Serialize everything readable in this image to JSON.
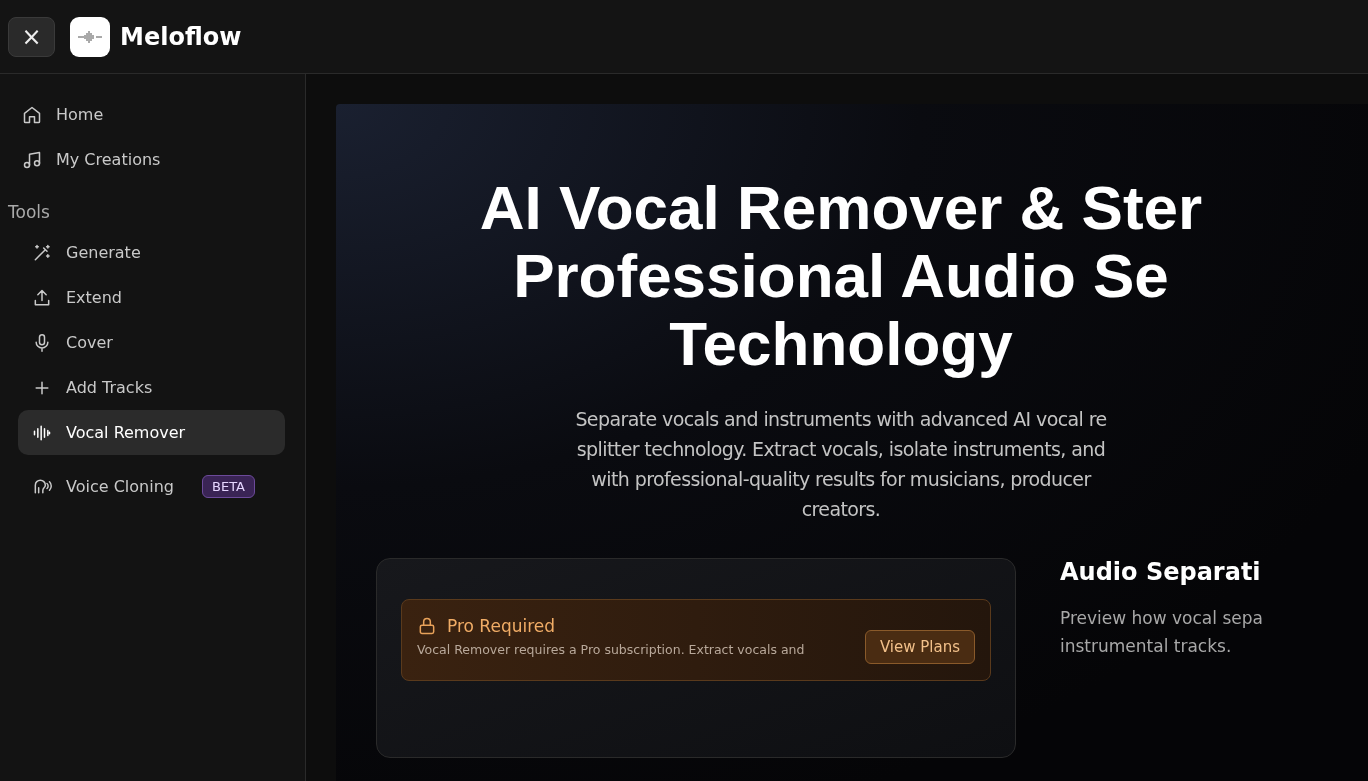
{
  "header": {
    "close_label": "×",
    "brand": "Meloflow"
  },
  "sidebar": {
    "items": [
      {
        "label": "Home",
        "selected": false
      },
      {
        "label": "My Creations",
        "selected": false
      }
    ],
    "section_title": "Tools",
    "tools": [
      {
        "label": "Generate",
        "selected": false
      },
      {
        "label": "Extend",
        "selected": false
      },
      {
        "label": "Cover",
        "selected": false
      },
      {
        "label": "Add Tracks",
        "selected": false
      },
      {
        "label": "Vocal Remover",
        "selected": true
      },
      {
        "label": "Voice Cloning",
        "selected": false,
        "badge": "BETA"
      }
    ]
  },
  "hero": {
    "title_lines": [
      "AI Vocal Remover & Ster",
      "Professional Audio Se",
      "Technology"
    ],
    "subtitle_lines": [
      "Separate vocals and instruments with advanced AI vocal re",
      "splitter technology. Extract vocals, isolate instruments, and",
      "with professional-quality results for musicians, producer",
      "creators."
    ]
  },
  "notice": {
    "title": "Pro Required",
    "text": "Vocal Remover requires a Pro subscription. Extract vocals and",
    "button": "View Plans"
  },
  "preview": {
    "title": "Audio Separati",
    "text_lines": [
      "Preview how vocal sepa",
      "instrumental tracks."
    ]
  }
}
